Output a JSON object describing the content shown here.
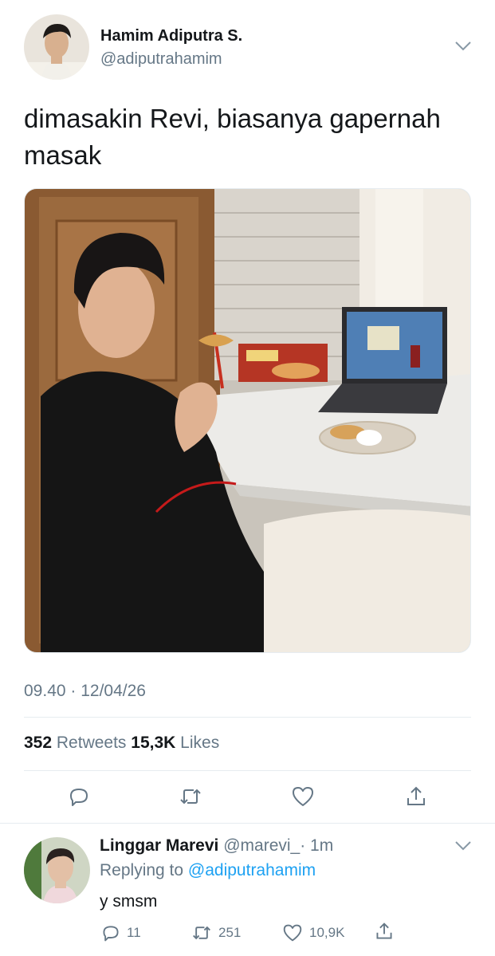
{
  "tweet": {
    "author_name": "Hamim Adiputra S.",
    "author_handle": "@adiputrahamim",
    "text_line1": "dimasakin Revi, biasanya gapernah",
    "text_line2": "masak",
    "timestamp": "09.40 · 12/04/26",
    "retweets_count": "352",
    "retweets_label": "Retweets",
    "likes_count": "15,3K",
    "likes_label": "Likes",
    "actions": {
      "reply_icon": "reply-icon",
      "retweet_icon": "retweet-icon",
      "like_icon": "heart-icon",
      "share_icon": "share-icon"
    }
  },
  "reply": {
    "author_name": "Linggar Marevi",
    "author_handle": "@marevi_",
    "time": "· 1m",
    "replying_prefix": "Replying to",
    "replying_to": "@adiputrahamim",
    "text": "y smsm",
    "reply_count": "11",
    "retweet_count": "251",
    "like_count": "10,9K"
  },
  "colors": {
    "text": "#14171a",
    "secondary": "#657786",
    "accent": "#1da1f2",
    "divider": "#e6ecf0"
  }
}
